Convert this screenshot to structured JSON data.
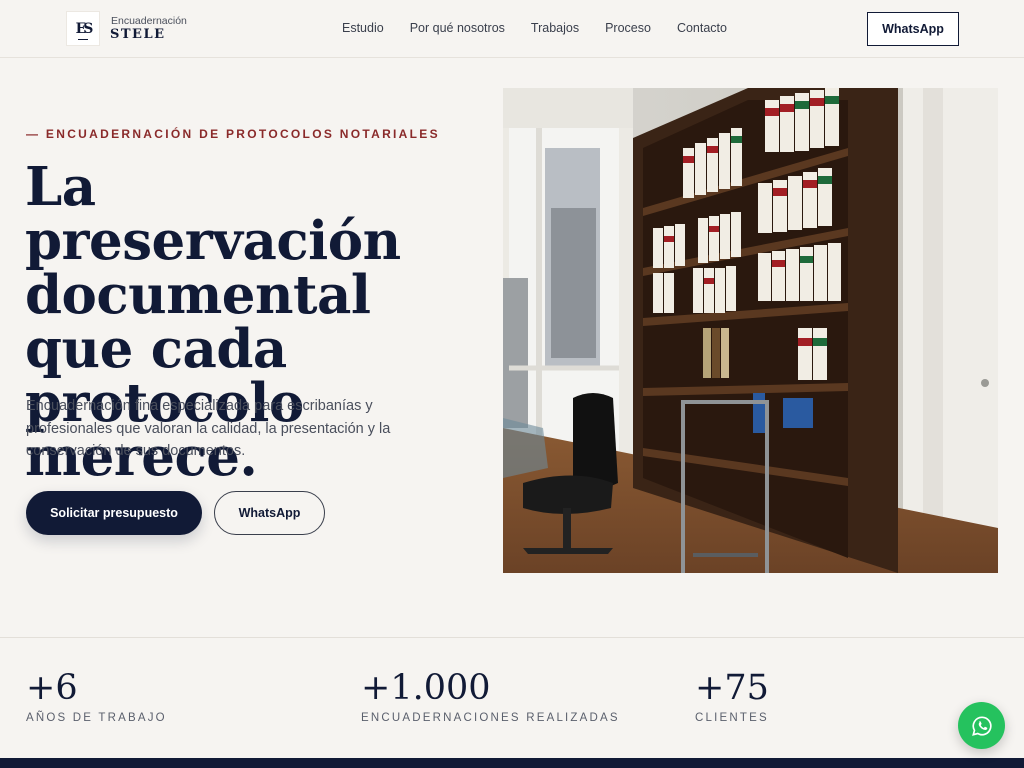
{
  "header": {
    "logo_mark": "ES",
    "brand_small": "Encuadernación",
    "brand_big": "STELE",
    "nav": [
      "Estudio",
      "Por qué nosotros",
      "Trabajos",
      "Proceso",
      "Contacto"
    ],
    "cta_label": "WhatsApp"
  },
  "hero": {
    "eyebrow": "— ENCUADERNACIÓN DE PROTOCOLOS NOTARIALES",
    "title": "La preservación documental que cada protocolo merece.",
    "subtitle": "Encuadernación fina especializada para escribanías y profesionales que valoran la calidad, la presentación y la conservación de sus documentos.",
    "primary_button": "Solicitar presupuesto",
    "secondary_button": "WhatsApp"
  },
  "stats": [
    {
      "value": "+6",
      "label": "AÑOS DE TRABAJO"
    },
    {
      "value": "+1.000",
      "label": "ENCUADERNACIONES REALIZADAS"
    },
    {
      "value": "+75",
      "label": "CLIENTES"
    }
  ],
  "floating_button": {
    "icon": "whatsapp-icon"
  },
  "colors": {
    "background": "#f6f4f1",
    "navy": "#111a36",
    "accent_red": "#8a2a2a",
    "whatsapp_green": "#25c25e"
  }
}
